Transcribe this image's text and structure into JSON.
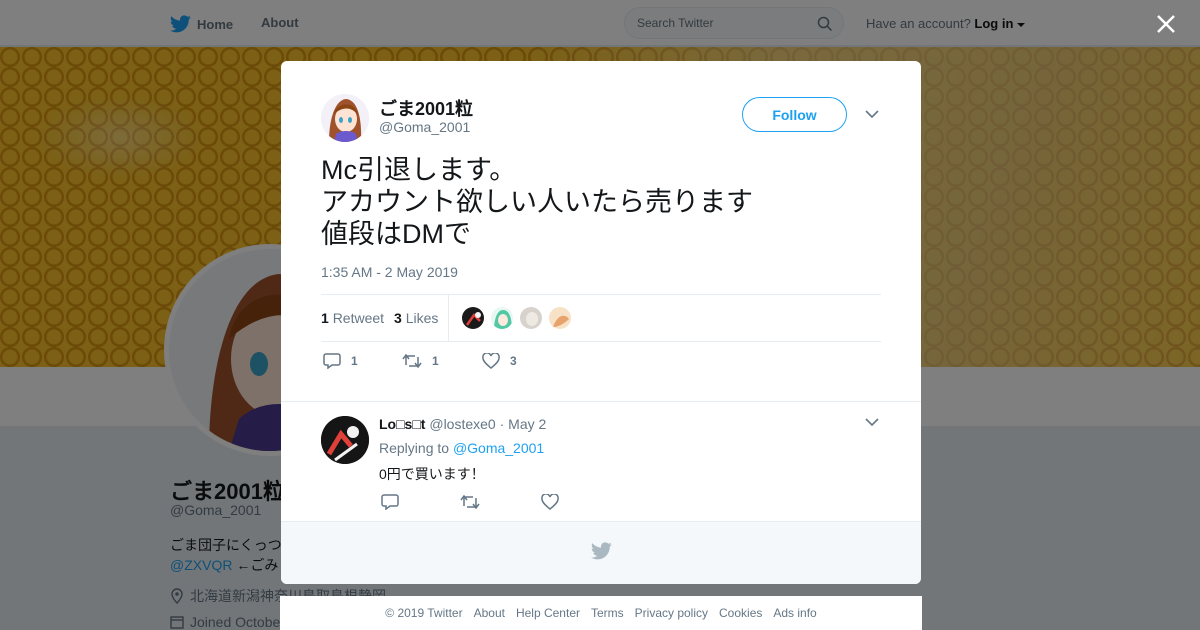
{
  "nav": {
    "home_label": "Home",
    "about_label": "About",
    "search_placeholder": "Search Twitter",
    "have_account": "Have an account?",
    "login_label": "Log in"
  },
  "profile": {
    "name": "ごま2001粒",
    "handle": "@Goma_2001",
    "bio_line1": "ごま団子にくっつ",
    "bio_mention": "@ZXVQR",
    "bio_line2_rest": " ←ごみ",
    "location": "北海道新潟神奈川鳥取島根静岡",
    "joined": "Joined Octobe"
  },
  "tweet": {
    "author_name": "ごま2001粒",
    "author_handle": "@Goma_2001",
    "follow_label": "Follow",
    "text": "Mc引退します。\nアカウント欲しい人いたら売ります\n値段はDMで",
    "timestamp": "1:35 AM - 2 May 2019",
    "retweet_count": "1",
    "retweet_label": "Retweet",
    "like_count": "3",
    "like_label": "Likes",
    "action_reply_count": "1",
    "action_retweet_count": "1",
    "action_like_count": "3"
  },
  "reply": {
    "author_name": "Lo□s□t",
    "author_handle": "@lostexe0",
    "date": "· May 2",
    "replying_prefix": "Replying to ",
    "replying_to": "@Goma_2001",
    "text": "0円で買います！"
  },
  "footer": {
    "copyright": "© 2019 Twitter",
    "about": "About",
    "help": "Help Center",
    "terms": "Terms",
    "privacy": "Privacy policy",
    "cookies": "Cookies",
    "ads": "Ads info"
  },
  "icons": {
    "twitter_bird": "twitter-bird-icon",
    "search": "search-icon",
    "close": "close-icon",
    "chevron": "chevron-down-icon",
    "reply": "reply-icon",
    "retweet": "retweet-icon",
    "like": "heart-icon",
    "location": "location-icon",
    "calendar": "calendar-icon"
  },
  "colors": {
    "accent": "#1da1f2",
    "text_primary": "#14171a",
    "text_secondary": "#657786"
  }
}
